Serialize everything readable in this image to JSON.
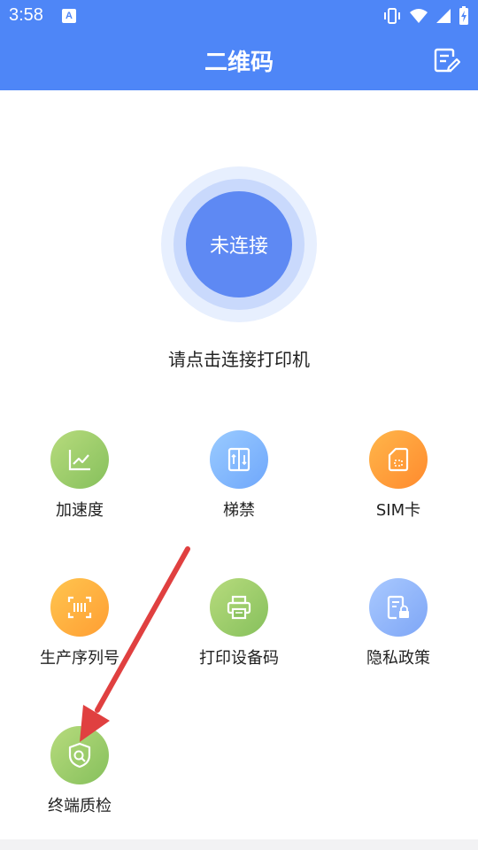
{
  "status_bar": {
    "time": "3:58",
    "notif_letter": "A"
  },
  "header": {
    "title": "二维码"
  },
  "connect": {
    "button_label": "未连接",
    "hint": "请点击连接打印机"
  },
  "grid": {
    "items": [
      {
        "label": "加速度",
        "icon": "chart-line-icon"
      },
      {
        "label": "梯禁",
        "icon": "elevator-icon"
      },
      {
        "label": "SIM卡",
        "icon": "sim-card-icon"
      },
      {
        "label": "生产序列号",
        "icon": "barcode-scan-icon"
      },
      {
        "label": "打印设备码",
        "icon": "printer-icon"
      },
      {
        "label": "隐私政策",
        "icon": "document-lock-icon"
      },
      {
        "label": "终端质检",
        "icon": "shield-search-icon"
      }
    ]
  },
  "colors": {
    "header": "#4E86F7",
    "connect_button": "#5E89F3",
    "annotation_arrow": "#E04040"
  }
}
